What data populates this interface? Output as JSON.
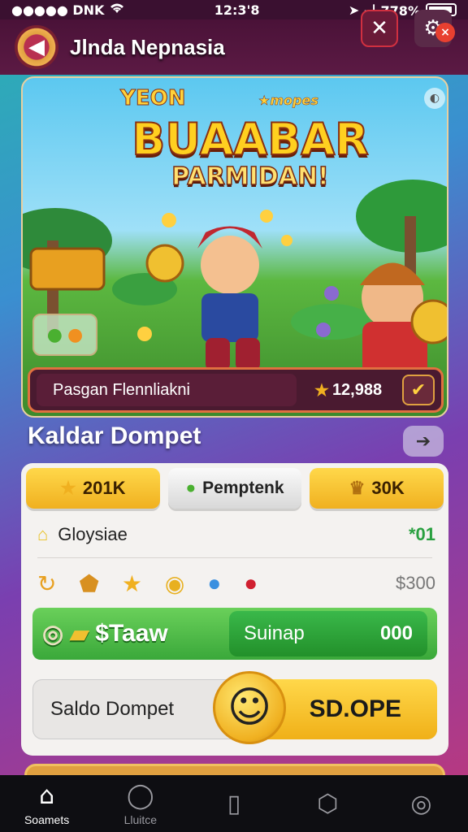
{
  "status_bar": {
    "carrier": "●●●●● DNK",
    "time": "12:3'8",
    "battery": "ᅴ 778%"
  },
  "header": {
    "title": "Jlnda Nepnasia",
    "badge_count": "×"
  },
  "banner": {
    "top_label": "YEON",
    "top_sub": "★mopes",
    "title": "BUAABAR",
    "subtitle": "PARMIDAN!"
  },
  "search": {
    "placeholder": "Pasgan Flennliakni",
    "score": "12,988"
  },
  "section": {
    "title": "Kaldar Dompet"
  },
  "wallet": {
    "tabs": [
      {
        "label": "201K",
        "icon": "star-icon"
      },
      {
        "label": "Pemptenk",
        "icon": "gem-icon"
      },
      {
        "label": "30K",
        "icon": "trophy-icon"
      }
    ],
    "row1": {
      "label": "Gloysiae",
      "value": "*01"
    },
    "row2": {
      "price": "$300"
    },
    "action": {
      "left_label": "$Taaw",
      "right_label": "Suinap",
      "right_value": "000"
    },
    "saldo": {
      "label": "Saldo Dompet",
      "value": "SD.OPE"
    }
  },
  "nav": {
    "items": [
      {
        "label": "Soamets",
        "icon": "home-icon"
      },
      {
        "label": "Lluitce",
        "icon": "chat-icon"
      },
      {
        "label": "",
        "icon": "card-icon"
      },
      {
        "label": "",
        "icon": "shield-icon"
      },
      {
        "label": "",
        "icon": "camera-icon"
      }
    ]
  },
  "colors": {
    "header_bg": "#4a1238",
    "gold": "#f0b020",
    "green": "#3aa83a",
    "nav_bg": "#0e0e12"
  }
}
